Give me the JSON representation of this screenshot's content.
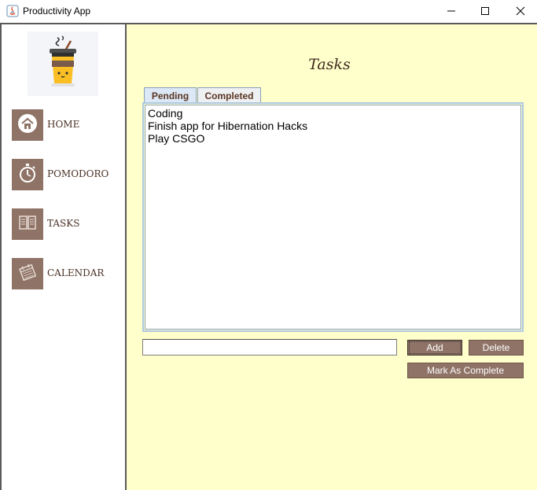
{
  "window": {
    "title": "Productivity App"
  },
  "sidebar": {
    "items": [
      {
        "label": "HOME",
        "icon": "home-icon"
      },
      {
        "label": "POMODORO",
        "icon": "stopwatch-icon"
      },
      {
        "label": "TASKS",
        "icon": "book-icon"
      },
      {
        "label": "CALENDAR",
        "icon": "calendar-icon"
      }
    ]
  },
  "main": {
    "title": "Tasks",
    "tabs": [
      {
        "label": "Pending",
        "selected": true
      },
      {
        "label": "Completed",
        "selected": false
      }
    ],
    "pending_tasks": [
      "Coding",
      "Finish app for Hibernation Hacks",
      "Play CSGO"
    ],
    "input": {
      "value": "",
      "placeholder": ""
    },
    "buttons": {
      "add": "Add",
      "delete": "Delete",
      "mark_complete": "Mark As Complete"
    }
  },
  "colors": {
    "main_bg": "#ffffcc",
    "accent_brown": "#8f7367",
    "label_brown": "#4a3124",
    "tab_border": "#8aa0b8"
  }
}
